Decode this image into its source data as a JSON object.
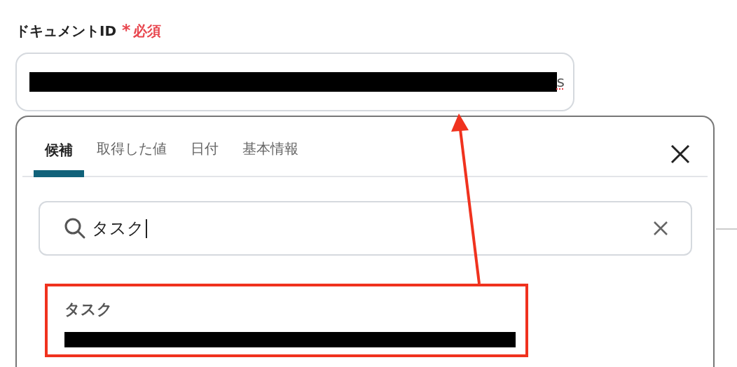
{
  "field": {
    "label": "ドキュメントID",
    "required_mark": "*",
    "required_text": "必須",
    "value_tail": "s",
    "spellcheck_error": true
  },
  "popup": {
    "tabs": [
      {
        "label": "候補",
        "selected": true
      },
      {
        "label": "取得した値",
        "selected": false
      },
      {
        "label": "日付",
        "selected": false
      },
      {
        "label": "基本情報",
        "selected": false
      }
    ],
    "search": {
      "value": "タスク"
    },
    "results": [
      {
        "title": "タスク",
        "highlighted": true
      }
    ]
  }
}
